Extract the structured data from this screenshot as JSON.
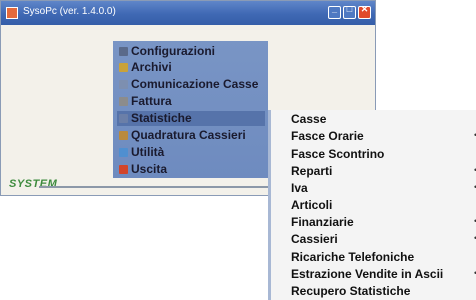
{
  "window": {
    "title": "SysoPc (ver. 1.4.0.0)",
    "minimize_glyph": "_",
    "maximize_glyph": "□",
    "close_glyph": "✕"
  },
  "menu": {
    "items": [
      {
        "label": "Configurazioni",
        "icon": "wrench-icon",
        "color": "#5a6a8a"
      },
      {
        "label": "Archivi",
        "icon": "folder-icon",
        "color": "#c9a23a"
      },
      {
        "label": "Comunicazione Casse",
        "icon": "network-icon",
        "color": "#7d8fb0"
      },
      {
        "label": "Fattura",
        "icon": "printer-icon",
        "color": "#8c8c8c"
      },
      {
        "label": "Statistiche",
        "icon": "chart-icon",
        "color": "#6b7fa8",
        "selected": true
      },
      {
        "label": "Quadratura Cassieri",
        "icon": "calculator-icon",
        "color": "#b98a3e"
      },
      {
        "label": "Utilità",
        "icon": "tools-icon",
        "color": "#4f8fd0"
      },
      {
        "label": "Uscita",
        "icon": "exit-icon",
        "color": "#d2452a"
      }
    ]
  },
  "submenu": {
    "items": [
      {
        "label": "Casse",
        "has_submenu": false
      },
      {
        "label": "Fasce Orarie",
        "has_submenu": true
      },
      {
        "label": "Fasce Scontrino",
        "has_submenu": false
      },
      {
        "label": "Reparti",
        "has_submenu": true
      },
      {
        "label": "Iva",
        "has_submenu": true
      },
      {
        "label": "Articoli",
        "has_submenu": false
      },
      {
        "label": "Finanziarie",
        "has_submenu": true
      },
      {
        "label": "Cassieri",
        "has_submenu": true
      },
      {
        "label": "Ricariche Telefoniche",
        "has_submenu": false
      },
      {
        "label": "Estrazione Vendite in Ascii",
        "has_submenu": true
      },
      {
        "label": "Recupero Statistiche",
        "has_submenu": false
      }
    ],
    "arrow_glyph": "•"
  },
  "brand": {
    "text": "SYSTEM",
    "color": "#3d8b3d"
  }
}
